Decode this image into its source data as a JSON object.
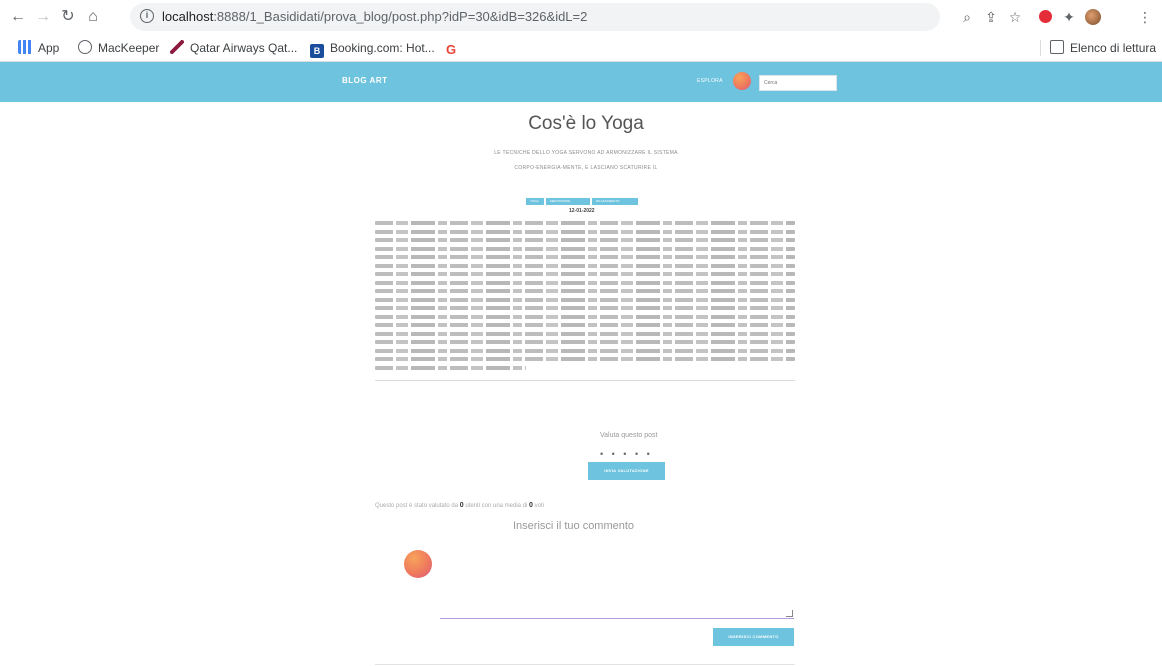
{
  "browser": {
    "url_host": "localhost",
    "url_rest": ":8888/1_Basididati/prova_blog/post.php?idP=30&idB=326&idL=2",
    "bookmarks": [
      {
        "label": "App",
        "color": "#4285f4"
      },
      {
        "label": "MacKeeper",
        "color": "#9aa0a6"
      },
      {
        "label": "Qatar Airways Qat...",
        "color": "#8c1d40"
      },
      {
        "label": "Booking.com: Hot...",
        "color": "#1a4d9c"
      },
      {
        "label": "",
        "color": "#ea4335"
      }
    ],
    "reading_list": "Elenco di lettura"
  },
  "site": {
    "brand": "BLOG ART",
    "header_link": "ESPLORA",
    "search_placeholder": "Cerca",
    "accent": "#6ec3de"
  },
  "post": {
    "title": "Cos'è lo Yoga",
    "subtitle_line1": "LE TECNICHE DELLO YOGA SERVONO AD ARMONIZZARE IL SISTEMA",
    "subtitle_line2": "CORPO-ENERGIA-MENTE, E LASCIANO SCATURIRE IL",
    "tags": [
      "YOGA",
      "MEDITAZIONE",
      "RILASSAMENTO"
    ],
    "date": "12-01-2022"
  },
  "vote": {
    "label": "Valuta questo post",
    "stars": "• • • • •",
    "button": "INVIA VALUTAZIONE"
  },
  "rating": {
    "prefix": "Questo post è stato valutato da",
    "users": "0",
    "middle": "utenti con una media di",
    "average": "0",
    "suffix": "voti"
  },
  "comment": {
    "title": "Inserisci il tuo commento",
    "button": "INSERISCI COMMENTO"
  }
}
